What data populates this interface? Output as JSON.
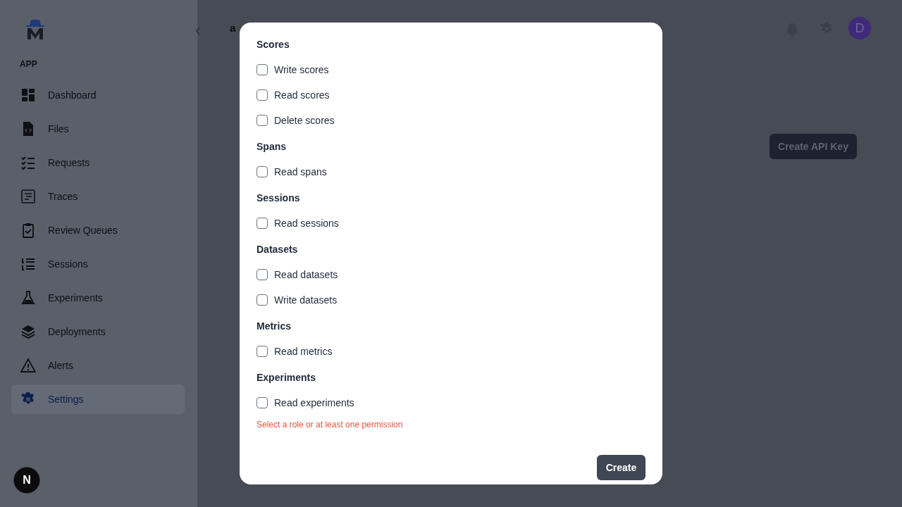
{
  "sidebar": {
    "section_label": "APP",
    "items": [
      {
        "label": "Dashboard",
        "selected": false
      },
      {
        "label": "Files",
        "selected": false
      },
      {
        "label": "Requests",
        "selected": false
      },
      {
        "label": "Traces",
        "selected": false
      },
      {
        "label": "Review Queues",
        "selected": false
      },
      {
        "label": "Sessions",
        "selected": false
      },
      {
        "label": "Experiments",
        "selected": false
      },
      {
        "label": "Deployments",
        "selected": false
      },
      {
        "label": "Alerts",
        "selected": false
      },
      {
        "label": "Settings",
        "selected": true
      }
    ]
  },
  "header": {
    "breadcrumb": "a",
    "avatar": "D"
  },
  "page": {
    "create_button": "Create API Key"
  },
  "dev_badge": "N",
  "modal": {
    "groups": [
      {
        "title": "Scores",
        "permissions": [
          {
            "label": "Write scores",
            "checked": false
          },
          {
            "label": "Read scores",
            "checked": false
          },
          {
            "label": "Delete scores",
            "checked": false
          }
        ]
      },
      {
        "title": "Spans",
        "permissions": [
          {
            "label": "Read spans",
            "checked": false
          }
        ]
      },
      {
        "title": "Sessions",
        "permissions": [
          {
            "label": "Read sessions",
            "checked": false
          }
        ]
      },
      {
        "title": "Datasets",
        "permissions": [
          {
            "label": "Read datasets",
            "checked": false
          },
          {
            "label": "Write datasets",
            "checked": false
          }
        ]
      },
      {
        "title": "Metrics",
        "permissions": [
          {
            "label": "Read metrics",
            "checked": false
          }
        ]
      },
      {
        "title": "Experiments",
        "permissions": [
          {
            "label": "Read experiments",
            "checked": false
          }
        ]
      }
    ],
    "error": "Select a role or at least one permission",
    "submit": "Create"
  }
}
